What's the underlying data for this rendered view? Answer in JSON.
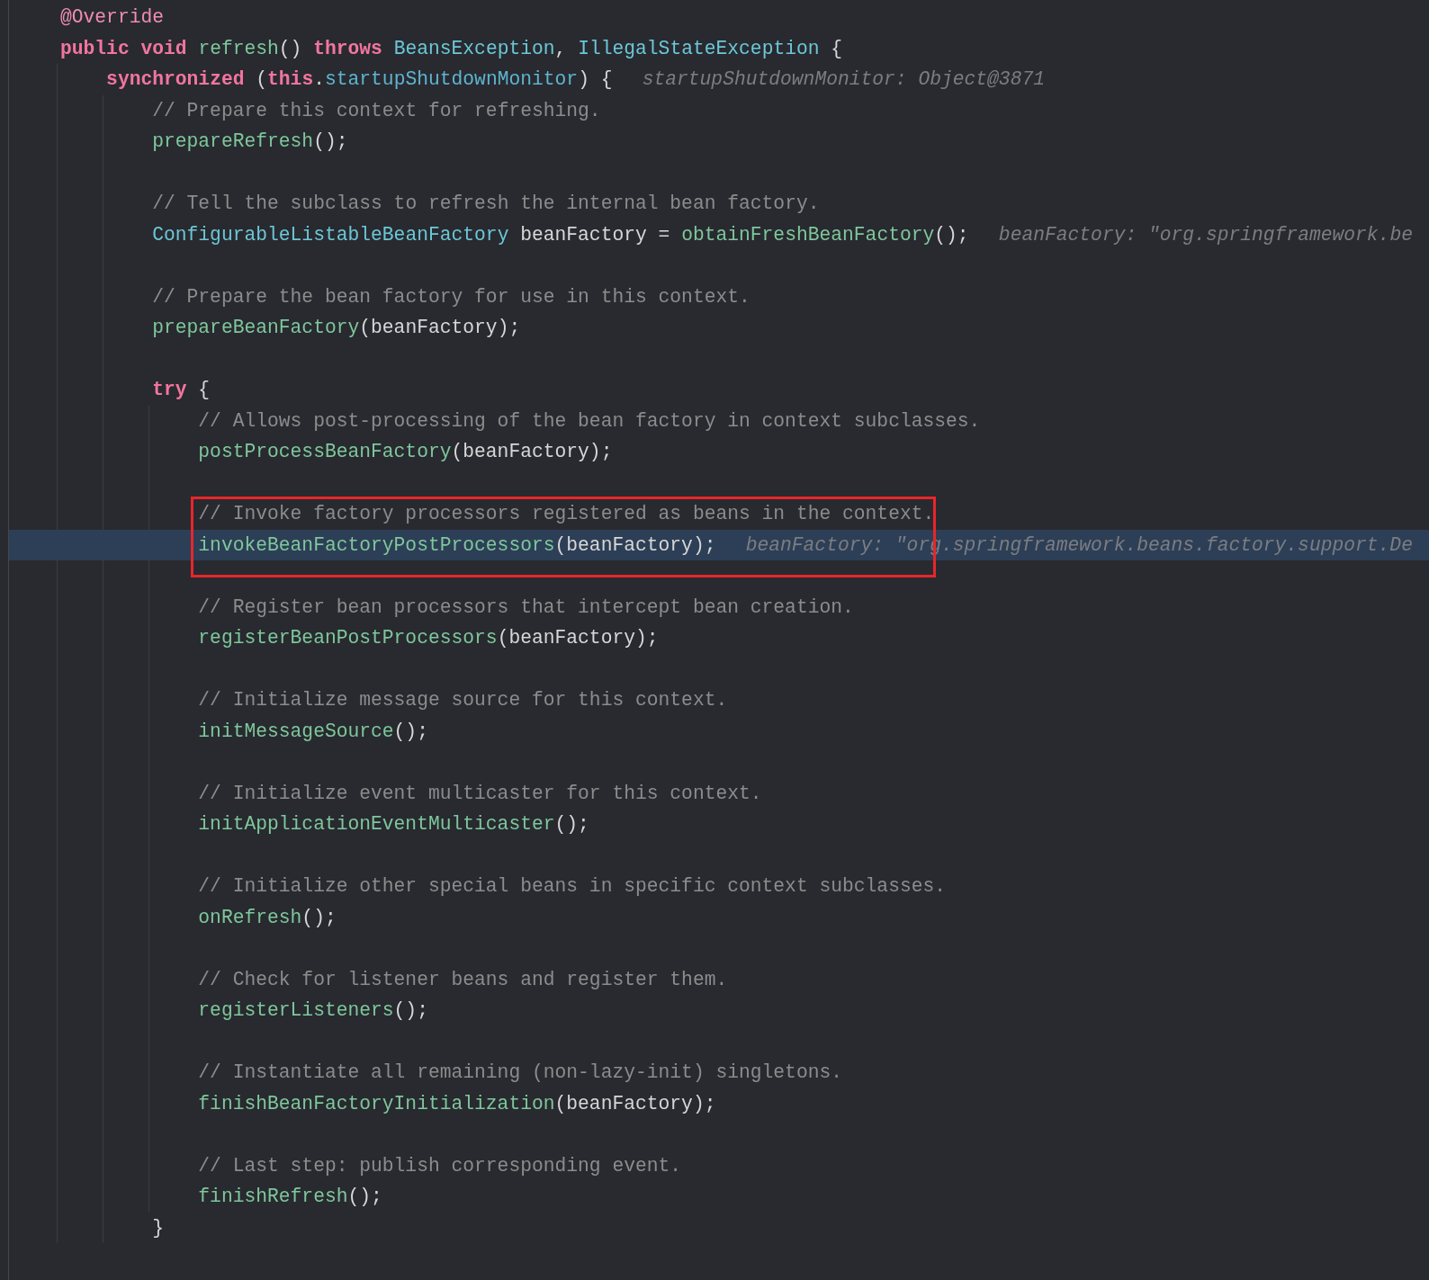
{
  "editor": {
    "items": [
      {
        "kind": "line",
        "current": false,
        "tokens": [
          {
            "kind": "annotation",
            "text": "@Override"
          }
        ]
      },
      {
        "kind": "line",
        "current": false,
        "tokens": [
          {
            "kind": "keyword",
            "text": "public "
          },
          {
            "kind": "keyword",
            "text": "void "
          },
          {
            "kind": "method",
            "text": "refresh"
          },
          {
            "kind": "plain",
            "text": "() "
          },
          {
            "kind": "keyword",
            "text": "throws "
          },
          {
            "kind": "type",
            "text": "BeansException"
          },
          {
            "kind": "plain",
            "text": ", "
          },
          {
            "kind": "type",
            "text": "IllegalStateException"
          },
          {
            "kind": "plain",
            "text": " {"
          }
        ]
      },
      {
        "kind": "block",
        "children": [
          {
            "kind": "line",
            "current": false,
            "tokens": [
              {
                "kind": "keyword",
                "text": "synchronized"
              },
              {
                "kind": "plain",
                "text": " ("
              },
              {
                "kind": "keyword",
                "text": "this"
              },
              {
                "kind": "plain",
                "text": "."
              },
              {
                "kind": "field",
                "text": "startupShutdownMonitor"
              },
              {
                "kind": "plain",
                "text": ") {"
              },
              {
                "kind": "hint",
                "text": "startupShutdownMonitor: Object@3871"
              }
            ]
          },
          {
            "kind": "block",
            "children": [
              {
                "kind": "line",
                "current": false,
                "tokens": [
                  {
                    "kind": "comment",
                    "text": "// Prepare this context for refreshing."
                  }
                ]
              },
              {
                "kind": "line",
                "current": false,
                "tokens": [
                  {
                    "kind": "method",
                    "text": "prepareRefresh"
                  },
                  {
                    "kind": "plain",
                    "text": "();"
                  }
                ]
              },
              {
                "kind": "blank"
              },
              {
                "kind": "line",
                "current": false,
                "tokens": [
                  {
                    "kind": "comment",
                    "text": "// Tell the subclass to refresh the internal bean factory."
                  }
                ]
              },
              {
                "kind": "line",
                "current": false,
                "tokens": [
                  {
                    "kind": "type",
                    "text": "ConfigurableListableBeanFactory"
                  },
                  {
                    "kind": "plain",
                    "text": " beanFactory = "
                  },
                  {
                    "kind": "method",
                    "text": "obtainFreshBeanFactory"
                  },
                  {
                    "kind": "plain",
                    "text": "();"
                  },
                  {
                    "kind": "hint",
                    "text": "beanFactory: \"org.springframework.be"
                  }
                ]
              },
              {
                "kind": "blank"
              },
              {
                "kind": "line",
                "current": false,
                "tokens": [
                  {
                    "kind": "comment",
                    "text": "// Prepare the bean factory for use in this context."
                  }
                ]
              },
              {
                "kind": "line",
                "current": false,
                "tokens": [
                  {
                    "kind": "method",
                    "text": "prepareBeanFactory"
                  },
                  {
                    "kind": "plain",
                    "text": "(beanFactory);"
                  }
                ]
              },
              {
                "kind": "blank"
              },
              {
                "kind": "line",
                "current": false,
                "tokens": [
                  {
                    "kind": "keyword",
                    "text": "try"
                  },
                  {
                    "kind": "plain",
                    "text": " {"
                  }
                ]
              },
              {
                "kind": "block",
                "children": [
                  {
                    "kind": "line",
                    "current": false,
                    "tokens": [
                      {
                        "kind": "comment",
                        "text": "// Allows post-processing of the bean factory in context subclasses."
                      }
                    ]
                  },
                  {
                    "kind": "line",
                    "current": false,
                    "tokens": [
                      {
                        "kind": "method",
                        "text": "postProcessBeanFactory"
                      },
                      {
                        "kind": "plain",
                        "text": "(beanFactory);"
                      }
                    ]
                  },
                  {
                    "kind": "blank"
                  },
                  {
                    "kind": "boxed",
                    "children": [
                      {
                        "kind": "line",
                        "current": false,
                        "tokens": [
                          {
                            "kind": "comment",
                            "text": "// Invoke factory processors registered as beans in the context."
                          }
                        ]
                      },
                      {
                        "kind": "line",
                        "current": true,
                        "tokens": [
                          {
                            "kind": "method",
                            "text": "invokeBeanFactoryPostProcessors"
                          },
                          {
                            "kind": "plain",
                            "text": "(beanFactory);"
                          },
                          {
                            "kind": "hint",
                            "text": "beanFactory: \"org.springframework.beans.factory.support.De"
                          }
                        ]
                      }
                    ]
                  },
                  {
                    "kind": "blank"
                  },
                  {
                    "kind": "line",
                    "current": false,
                    "tokens": [
                      {
                        "kind": "comment",
                        "text": "// Register bean processors that intercept bean creation."
                      }
                    ]
                  },
                  {
                    "kind": "line",
                    "current": false,
                    "tokens": [
                      {
                        "kind": "method",
                        "text": "registerBeanPostProcessors"
                      },
                      {
                        "kind": "plain",
                        "text": "(beanFactory);"
                      }
                    ]
                  },
                  {
                    "kind": "blank"
                  },
                  {
                    "kind": "line",
                    "current": false,
                    "tokens": [
                      {
                        "kind": "comment",
                        "text": "// Initialize message source for this context."
                      }
                    ]
                  },
                  {
                    "kind": "line",
                    "current": false,
                    "tokens": [
                      {
                        "kind": "method",
                        "text": "initMessageSource"
                      },
                      {
                        "kind": "plain",
                        "text": "();"
                      }
                    ]
                  },
                  {
                    "kind": "blank"
                  },
                  {
                    "kind": "line",
                    "current": false,
                    "tokens": [
                      {
                        "kind": "comment",
                        "text": "// Initialize event multicaster for this context."
                      }
                    ]
                  },
                  {
                    "kind": "line",
                    "current": false,
                    "tokens": [
                      {
                        "kind": "method",
                        "text": "initApplicationEventMulticaster"
                      },
                      {
                        "kind": "plain",
                        "text": "();"
                      }
                    ]
                  },
                  {
                    "kind": "blank"
                  },
                  {
                    "kind": "line",
                    "current": false,
                    "tokens": [
                      {
                        "kind": "comment",
                        "text": "// Initialize other special beans in specific context subclasses."
                      }
                    ]
                  },
                  {
                    "kind": "line",
                    "current": false,
                    "tokens": [
                      {
                        "kind": "method",
                        "text": "onRefresh"
                      },
                      {
                        "kind": "plain",
                        "text": "();"
                      }
                    ]
                  },
                  {
                    "kind": "blank"
                  },
                  {
                    "kind": "line",
                    "current": false,
                    "tokens": [
                      {
                        "kind": "comment",
                        "text": "// Check for listener beans and register them."
                      }
                    ]
                  },
                  {
                    "kind": "line",
                    "current": false,
                    "tokens": [
                      {
                        "kind": "method",
                        "text": "registerListeners"
                      },
                      {
                        "kind": "plain",
                        "text": "();"
                      }
                    ]
                  },
                  {
                    "kind": "blank"
                  },
                  {
                    "kind": "line",
                    "current": false,
                    "tokens": [
                      {
                        "kind": "comment",
                        "text": "// Instantiate all remaining (non-lazy-init) singletons."
                      }
                    ]
                  },
                  {
                    "kind": "line",
                    "current": false,
                    "tokens": [
                      {
                        "kind": "method",
                        "text": "finishBeanFactoryInitialization"
                      },
                      {
                        "kind": "plain",
                        "text": "(beanFactory);"
                      }
                    ]
                  },
                  {
                    "kind": "blank"
                  },
                  {
                    "kind": "line",
                    "current": false,
                    "tokens": [
                      {
                        "kind": "comment",
                        "text": "// Last step: publish corresponding event."
                      }
                    ]
                  },
                  {
                    "kind": "line",
                    "current": false,
                    "tokens": [
                      {
                        "kind": "method",
                        "text": "finishRefresh"
                      },
                      {
                        "kind": "plain",
                        "text": "();"
                      }
                    ]
                  }
                ]
              },
              {
                "kind": "line",
                "current": false,
                "tokens": [
                  {
                    "kind": "plain",
                    "text": "}"
                  }
                ]
              }
            ]
          }
        ]
      }
    ]
  }
}
